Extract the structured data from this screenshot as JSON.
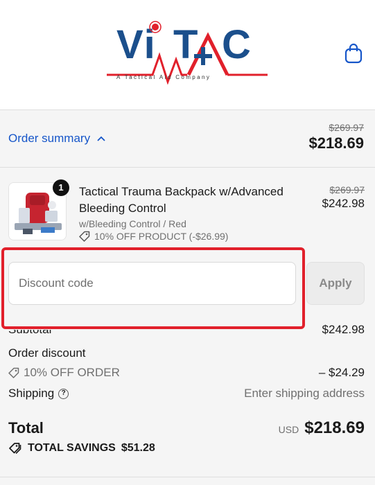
{
  "header": {
    "logo_main": "ViTAC",
    "logo_tagline": "A Tactical Aid Company"
  },
  "summary": {
    "toggle_label": "Order summary",
    "original_price": "$269.97",
    "total_price": "$218.69"
  },
  "line_item": {
    "quantity": "1",
    "name": "Tactical Trauma Backpack w/Advanced Bleeding Control",
    "variant": "w/Bleeding Control / Red",
    "discount": "10% OFF PRODUCT (-$26.99)",
    "original_price": "$269.97",
    "price": "$242.98"
  },
  "discount": {
    "placeholder": "Discount code",
    "apply_label": "Apply"
  },
  "totals": {
    "subtotal_label": "Subtotal",
    "subtotal_value": "$242.98",
    "order_discount_label": "Order discount",
    "order_discount_code": "10% OFF ORDER",
    "order_discount_value": "– $24.29",
    "shipping_label": "Shipping",
    "shipping_value": "Enter shipping address",
    "total_label": "Total",
    "currency": "USD",
    "total_value": "$218.69",
    "savings_label": "TOTAL SAVINGS",
    "savings_value": "$51.28"
  },
  "colors": {
    "link_blue": "#1656c9",
    "brand_blue": "#1b4f8c",
    "brand_red": "#e1202b",
    "highlight_red": "#e1202b"
  },
  "icons": [
    "shopping-bag-icon",
    "chevron-up-icon",
    "tag-icon",
    "help-circle-icon"
  ]
}
